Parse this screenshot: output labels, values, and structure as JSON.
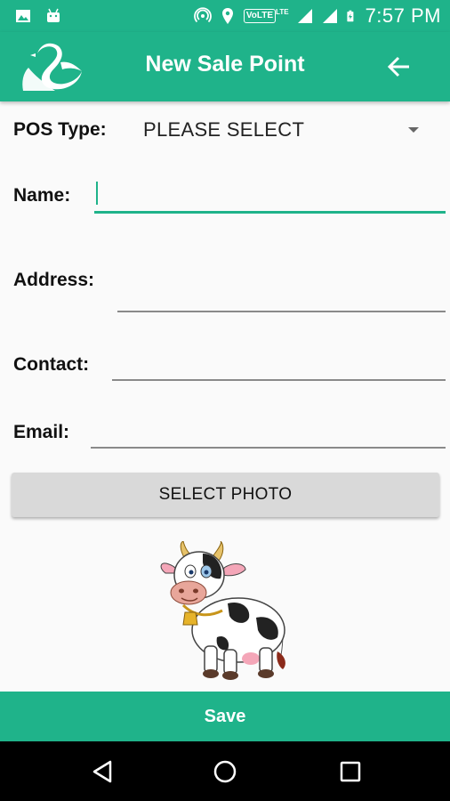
{
  "status_bar": {
    "time": "7:57 PM",
    "network_badge": "VoLTE",
    "lte_label": "LTE",
    "icons": [
      "image-icon",
      "android-icon",
      "hotspot-icon",
      "location-icon",
      "signal-icon",
      "signal-icon",
      "battery-charging-icon"
    ]
  },
  "app_bar": {
    "title": "New Sale Point",
    "logo": "swan-logo",
    "back_icon": "arrow-left-icon"
  },
  "form": {
    "pos_type": {
      "label": "POS Type:",
      "selected": "PLEASE SELECT"
    },
    "name": {
      "label": "Name:",
      "value": ""
    },
    "address": {
      "label": "Address:",
      "value": ""
    },
    "contact": {
      "label": "Contact:",
      "value": ""
    },
    "email": {
      "label": "Email:",
      "value": ""
    }
  },
  "select_photo_label": "SELECT PHOTO",
  "image": "cow-illustration",
  "save_label": "Save",
  "nav_bar": {
    "icons": [
      "back-triangle-icon",
      "home-circle-icon",
      "recents-square-icon"
    ]
  },
  "colors": {
    "primary": "#1fb38a",
    "background": "#fafafa",
    "button_grey": "#d9d9d9"
  }
}
